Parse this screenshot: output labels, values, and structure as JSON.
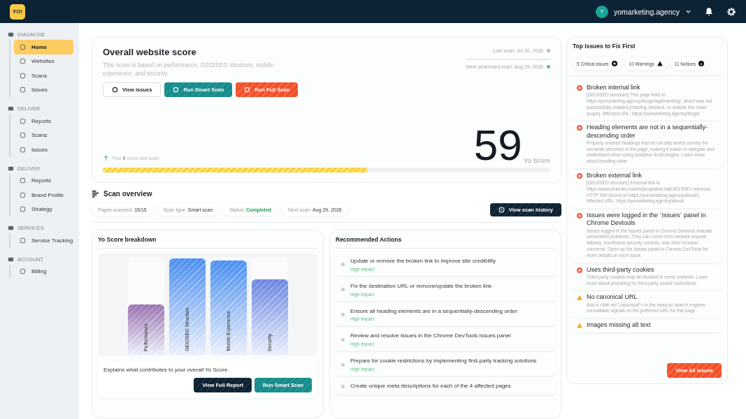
{
  "topbar": {
    "logo": "YO!",
    "account": {
      "initial": "Y",
      "name": "yomarketing.agency"
    }
  },
  "sidebar": [
    {
      "title": "DIAGNOSE",
      "items": [
        {
          "label": "Home",
          "selected": true
        },
        {
          "label": "Websites",
          "selected": false
        },
        {
          "label": "Scans",
          "selected": false
        },
        {
          "label": "Issues",
          "selected": false
        }
      ]
    },
    {
      "title": "DELIVER",
      "items": [
        {
          "label": "Reports",
          "selected": false
        },
        {
          "label": "Scans",
          "selected": false
        },
        {
          "label": "Issues",
          "selected": false
        }
      ]
    },
    {
      "title": "DELIVER",
      "items": [
        {
          "label": "Reports",
          "selected": false
        },
        {
          "label": "Brand Profile",
          "selected": false
        },
        {
          "label": "Strategy",
          "selected": false
        }
      ]
    },
    {
      "title": "SERVICES",
      "items": [
        {
          "label": "Service Tracking",
          "selected": false
        }
      ]
    },
    {
      "title": "ACCOUNT",
      "items": [
        {
          "label": "Billing",
          "selected": false
        }
      ]
    }
  ],
  "score_card": {
    "title": "Overall website score",
    "description": "This score is based on performance, GEO/SEO structure, mobile experience, and security.",
    "buttons": [
      {
        "label": "View issues",
        "kind": "outline"
      },
      {
        "label": "Run Smart Scan",
        "kind": "teal"
      },
      {
        "label": "Run Full Scan",
        "kind": "orange"
      }
    ],
    "scans": [
      {
        "text": "Last scan: Jul 30, 2026",
        "color": "#b5b9bd"
      },
      {
        "text": "Next scheduled scan: Aug 29, 2026",
        "color": "#5cc08a"
      }
    ],
    "change": {
      "before": "Plus ",
      "value": "0",
      "after": " since last scan"
    },
    "score": "59",
    "score_label": "Yo Score",
    "level": 0.59
  },
  "scan_overview": {
    "title": "Scan overview",
    "chips": [
      {
        "label": "Pages scanned:",
        "value": "15/15"
      },
      {
        "label": "Scan type:",
        "value": "Smart scan"
      },
      {
        "label": "Status:",
        "value": "Completed"
      },
      {
        "label": "Next scan:",
        "value": "Aug 29, 2026"
      }
    ],
    "history_button": "View scan history"
  },
  "breakdown": {
    "title": "Yo Score breakdown",
    "bars": [
      {
        "label": "Performance",
        "level": 0.52
      },
      {
        "label": "GEO/SEO Structure",
        "level": 0.99
      },
      {
        "label": "Mobile Experience",
        "level": 0.97
      },
      {
        "label": "Security",
        "level": 0.78
      }
    ],
    "footer": "Explains what contributes to your overall Yo Score.",
    "buttons": [
      {
        "label": "View Full Report",
        "kind": "dark"
      },
      {
        "label": "Run Smart Scan",
        "kind": "teal"
      }
    ]
  },
  "actions": {
    "title": "Recommended Actions",
    "items": [
      {
        "text": "Update or remove the broken link to improve site credibility",
        "impact": "High impact"
      },
      {
        "text": "Fix the destination URL or remove/update the broken link",
        "impact": "High impact"
      },
      {
        "text": "Ensure all heading elements are in a sequentially-descending order",
        "impact": "High impact"
      },
      {
        "text": "Review and resolve issues in the Chrome DevTools Issues panel",
        "impact": "High impact"
      },
      {
        "text": "Prepare for cookie restrictions by implementing first-party tracking solutions",
        "impact": "High impact"
      },
      {
        "text": "Create unique meta descriptions for each of the 4 affected pages"
      }
    ]
  },
  "top_issues": {
    "title": "Top Issues to Fix First",
    "counts": [
      {
        "label": "5 Critical issues",
        "kind": "critical"
      },
      {
        "label": "10 Warnings",
        "kind": "warning"
      },
      {
        "label": "11 Notices",
        "kind": "notice"
      }
    ],
    "items": [
      {
        "kind": "critical",
        "title": "Broken internal link",
        "description": "[GEO/SEO structure] This page links to https://yomarketing.agency/blogs/tag/branding/, which was not successfully crawled (missing, blocked, or outside the crawl scope). Affected URL: https://yomarketing.agency/blogs/"
      },
      {
        "kind": "critical",
        "title": "Heading elements are not in a sequentially-descending order",
        "description": "Properly ordered headings that do not skip levels convey the semantic structure of the page, making it easier to navigate and understand when using assistive technologies. Learn more about heading order."
      },
      {
        "kind": "critical",
        "title": "Broken external link",
        "description": "[GEO/SEO structure] External link to https://www.linkedin.com/in/jacqueline-ball-9019957/ returned HTTP 999 (found on https://yomarketing.agency/about/). Affected URL: https://yomarketing.agency/about/"
      },
      {
        "kind": "critical",
        "title": "Issues were logged in the `Issues` panel in Chrome Devtools",
        "description": "Issues logged to the Issues panel in Chrome Devtools indicate unresolved problems. They can come from network request failures, insufficient security controls, and other browser concerns. Open up the Issues panel in Chrome DevTools for more details on each issue."
      },
      {
        "kind": "critical",
        "title": "Uses third-party cookies",
        "description": "Third-party cookies may be blocked in some contexts. Learn more about preparing for third-party cookie restrictions."
      },
      {
        "kind": "warning",
        "title": "No canonical URL",
        "description": "Add a <link rel=\"canonical\"> in the head so search engines consolidate signals on the preferred URL for this page."
      },
      {
        "kind": "warning",
        "title": "Images missing alt text"
      }
    ],
    "button": "View All Issues"
  }
}
